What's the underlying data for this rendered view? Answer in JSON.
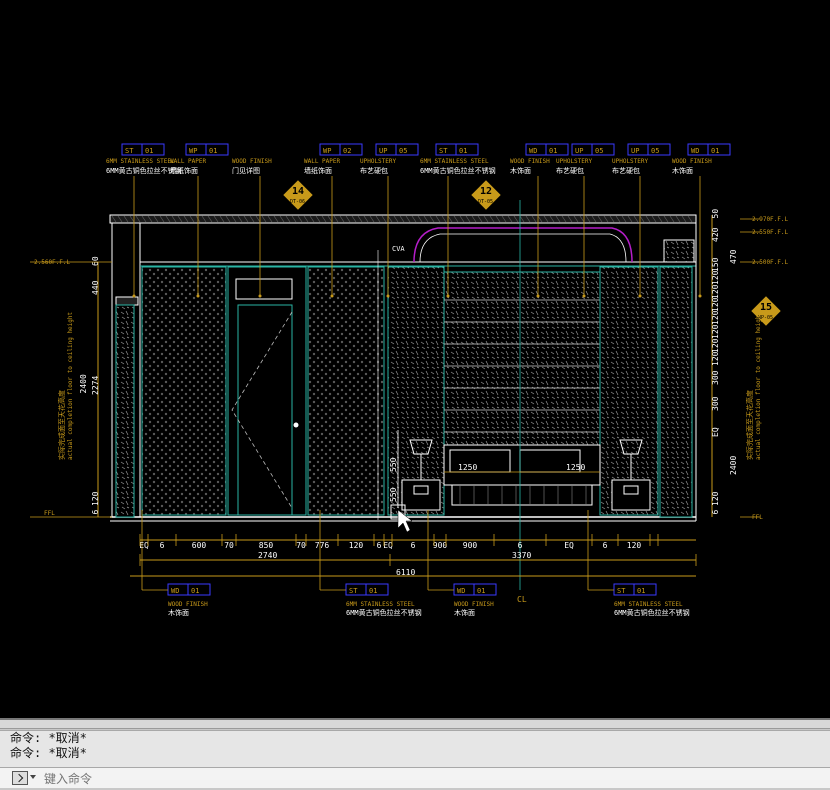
{
  "command_line": {
    "history": [
      "命令: *取消*",
      "命令: *取消*"
    ],
    "input_placeholder": "键入命令"
  },
  "drawing": {
    "colors": {
      "background": "#000000",
      "dimension": "#c89a1a",
      "outline": "#ffffff",
      "fill": "#2ab5a5",
      "tag": "#3a3aff",
      "magenta": "#b41ec8"
    },
    "tags_top": [
      {
        "code": "ST",
        "num": "01",
        "en": "6MM STAINLESS STEEL",
        "cn": "6MM黄古铜色拉丝不锈钢"
      },
      {
        "code": "WP",
        "num": "01",
        "en": "WALL PAPER",
        "cn": "墙纸饰面"
      },
      {
        "code": "",
        "num": "",
        "en": "WOOD FINISH",
        "cn": "门见详图"
      },
      {
        "code": "WP",
        "num": "02",
        "en": "WALL PAPER",
        "cn": "墙纸饰面"
      },
      {
        "code": "UP",
        "num": "05",
        "en": "UPHOLSTERY",
        "cn": "布艺硬包"
      },
      {
        "code": "ST",
        "num": "01",
        "en": "6MM STAINLESS STEEL",
        "cn": "6MM黄古铜色拉丝不锈钢"
      },
      {
        "code": "WD",
        "num": "01",
        "en": "WOOD FINISH",
        "cn": "木饰面"
      },
      {
        "code": "UP",
        "num": "05",
        "en": "UPHOLSTERY",
        "cn": "布艺硬包"
      },
      {
        "code": "UP",
        "num": "05",
        "en": "UPHOLSTERY",
        "cn": "布艺硬包"
      },
      {
        "code": "WD",
        "num": "01",
        "en": "WOOD FINISH",
        "cn": "木饰面"
      }
    ],
    "tags_bottom": [
      {
        "code": "WD",
        "num": "01",
        "en": "WOOD FINISH",
        "cn": "木饰面"
      },
      {
        "code": "ST",
        "num": "01",
        "en": "6MM STAINLESS STEEL",
        "cn": "6MM黄古铜色拉丝不锈钢"
      },
      {
        "code": "WD",
        "num": "01",
        "en": "WOOD FINISH",
        "cn": "木饰面"
      },
      {
        "code": "ST",
        "num": "01",
        "en": "6MM STAINLESS STEEL",
        "cn": "6MM黄古铜色拉丝不锈钢"
      }
    ],
    "section_markers": [
      {
        "num": "14",
        "ref": "DT-06"
      },
      {
        "num": "12",
        "ref": "DT-05"
      },
      {
        "num": "15",
        "ref": "WP-05"
      }
    ],
    "dims_bottom_row1": [
      "EQ",
      "6",
      "600",
      "70",
      "850",
      "70",
      "776",
      "120",
      "6",
      "EQ",
      "6",
      "900",
      "900",
      "6",
      "EQ",
      "6",
      "120"
    ],
    "dims_bottom_row2": [
      "2740",
      "3370"
    ],
    "dims_bottom_total": "6110",
    "dims_left": [
      "60",
      "440",
      "2274",
      "2400",
      "120",
      "6"
    ],
    "dims_right": [
      "50",
      "420",
      "470",
      "150",
      "120",
      "120",
      "120",
      "120",
      "120",
      "120",
      "120",
      "300",
      "300",
      "EQ",
      "2400",
      "120",
      "6"
    ],
    "level_left_top": "2.560F.F.L",
    "level_left_bottom": "FFL",
    "levels_right": [
      "2.970F.F.L",
      "2.550F.F.L",
      "2.500F.F.L",
      "FFL"
    ],
    "height_note_cn": "实际完成面至天花高度",
    "height_note_en": "actual completion floor to ceiling height",
    "bed_dims": [
      "1250",
      "1250"
    ],
    "bed_height": "550",
    "nightstand_height": "550",
    "centerline_label": "CL",
    "cva_label": "CVA"
  }
}
